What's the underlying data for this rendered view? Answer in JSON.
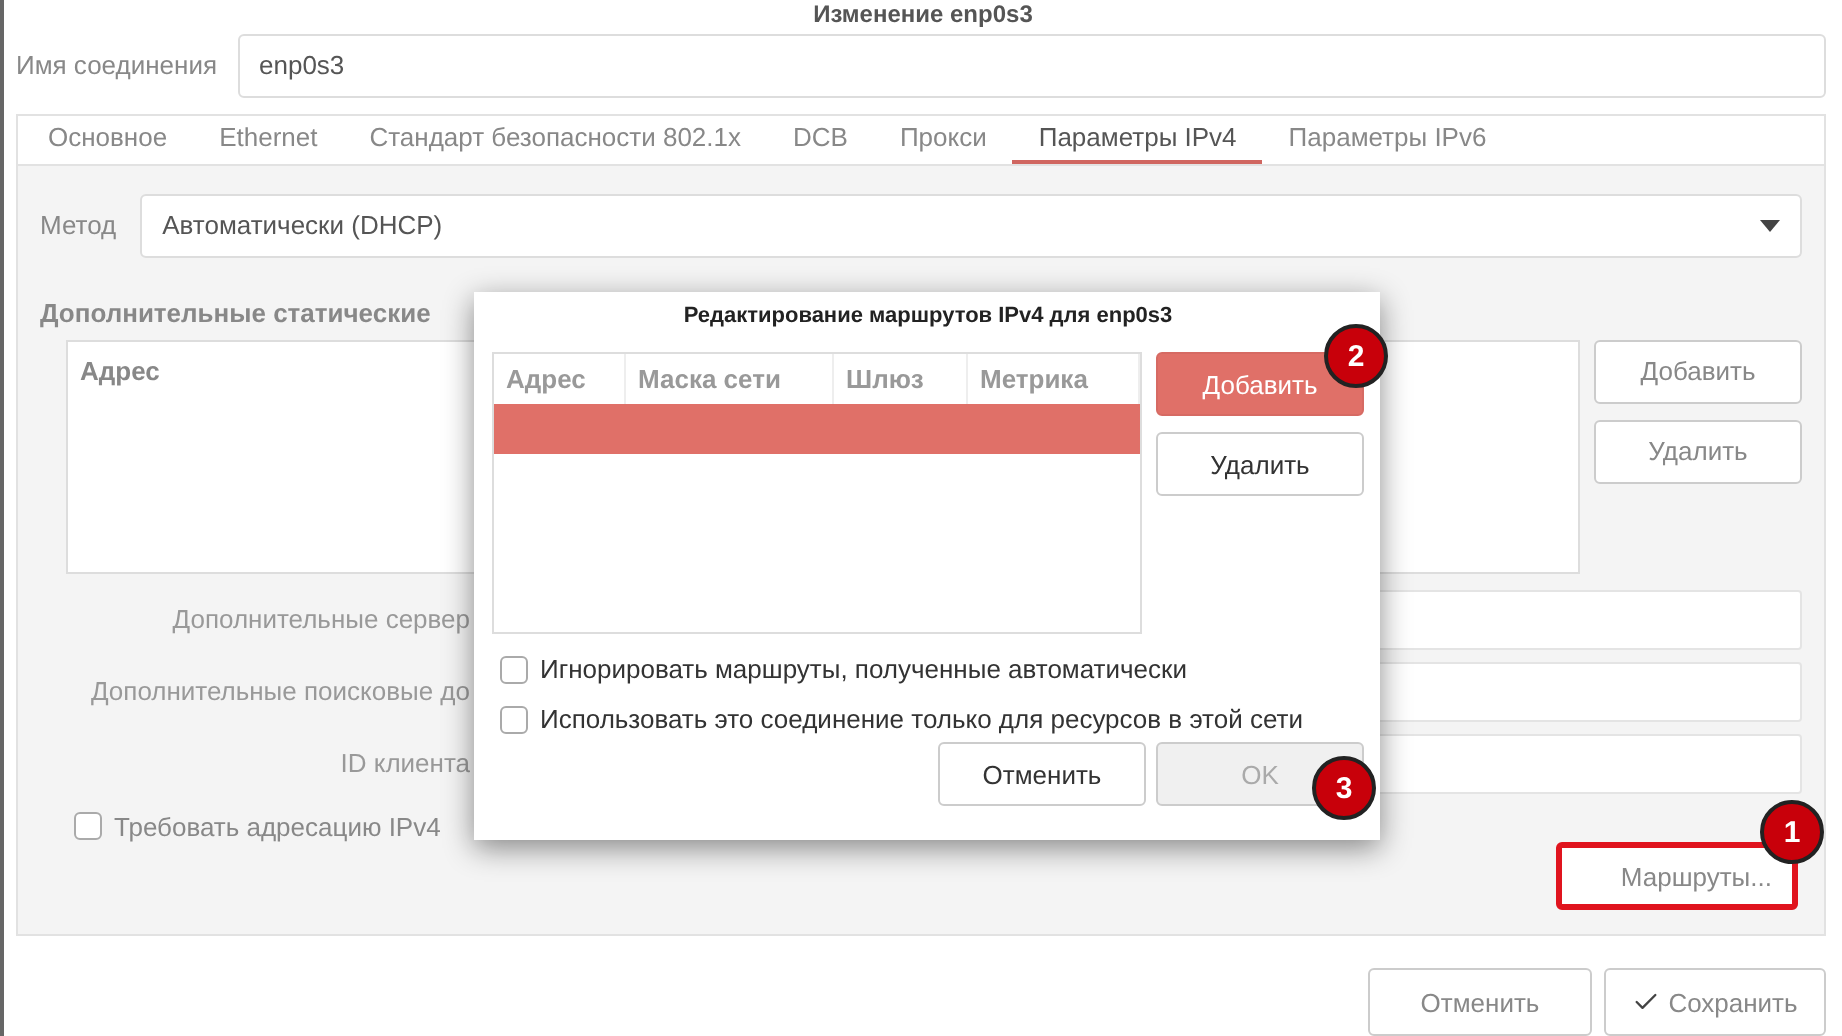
{
  "window": {
    "title": "Изменение enp0s3"
  },
  "connection_name": {
    "label": "Имя соединения",
    "value": "enp0s3"
  },
  "tabs": [
    {
      "label": "Основное",
      "selected": false
    },
    {
      "label": "Ethernet",
      "selected": false
    },
    {
      "label": "Стандарт безопасности 802.1x",
      "selected": false
    },
    {
      "label": "DCB",
      "selected": false
    },
    {
      "label": "Прокси",
      "selected": false
    },
    {
      "label": "Параметры IPv4",
      "selected": true
    },
    {
      "label": "Параметры IPv6",
      "selected": false
    }
  ],
  "method": {
    "label": "Метод",
    "value": "Автоматически (DHCP)"
  },
  "static_addresses": {
    "heading": "Дополнительные статические",
    "columns": [
      "Адрес"
    ],
    "buttons": [
      "Добавить",
      "Удалить"
    ]
  },
  "form_rows": [
    {
      "label": "Дополнительные сервер"
    },
    {
      "label": "Дополнительные поисковые до"
    },
    {
      "label": "ID клиента"
    }
  ],
  "require_ipv4": {
    "label": "Требовать адресацию IPv4",
    "checked": false
  },
  "routes_button": {
    "label": "Маршруты...",
    "highlighted": true
  },
  "footer_buttons": [
    {
      "label": "Отменить",
      "kind": "plain"
    },
    {
      "label": "Сохранить",
      "kind": "confirm"
    }
  ],
  "routes_dialog": {
    "title": "Редактирование маршрутов IPv4 для enp0s3",
    "columns": [
      "Адрес",
      "Маска сети",
      "Шлюз",
      "Метрика"
    ],
    "rows": [
      {
        "selected": true
      }
    ],
    "side_buttons": [
      {
        "label": "Добавить",
        "highlighted": true
      },
      {
        "label": "Удалить",
        "highlighted": false
      }
    ],
    "options": [
      {
        "label": "Игнорировать маршруты, полученные автоматически",
        "checked": false
      },
      {
        "label": "Использовать это соединение только для ресурсов в этой сети",
        "checked": false
      }
    ],
    "buttons": [
      {
        "label": "Отменить",
        "disabled": false
      },
      {
        "label": "OK",
        "disabled": true
      }
    ]
  },
  "annotations": [
    {
      "number": "1"
    },
    {
      "number": "2"
    },
    {
      "number": "3"
    }
  ]
}
